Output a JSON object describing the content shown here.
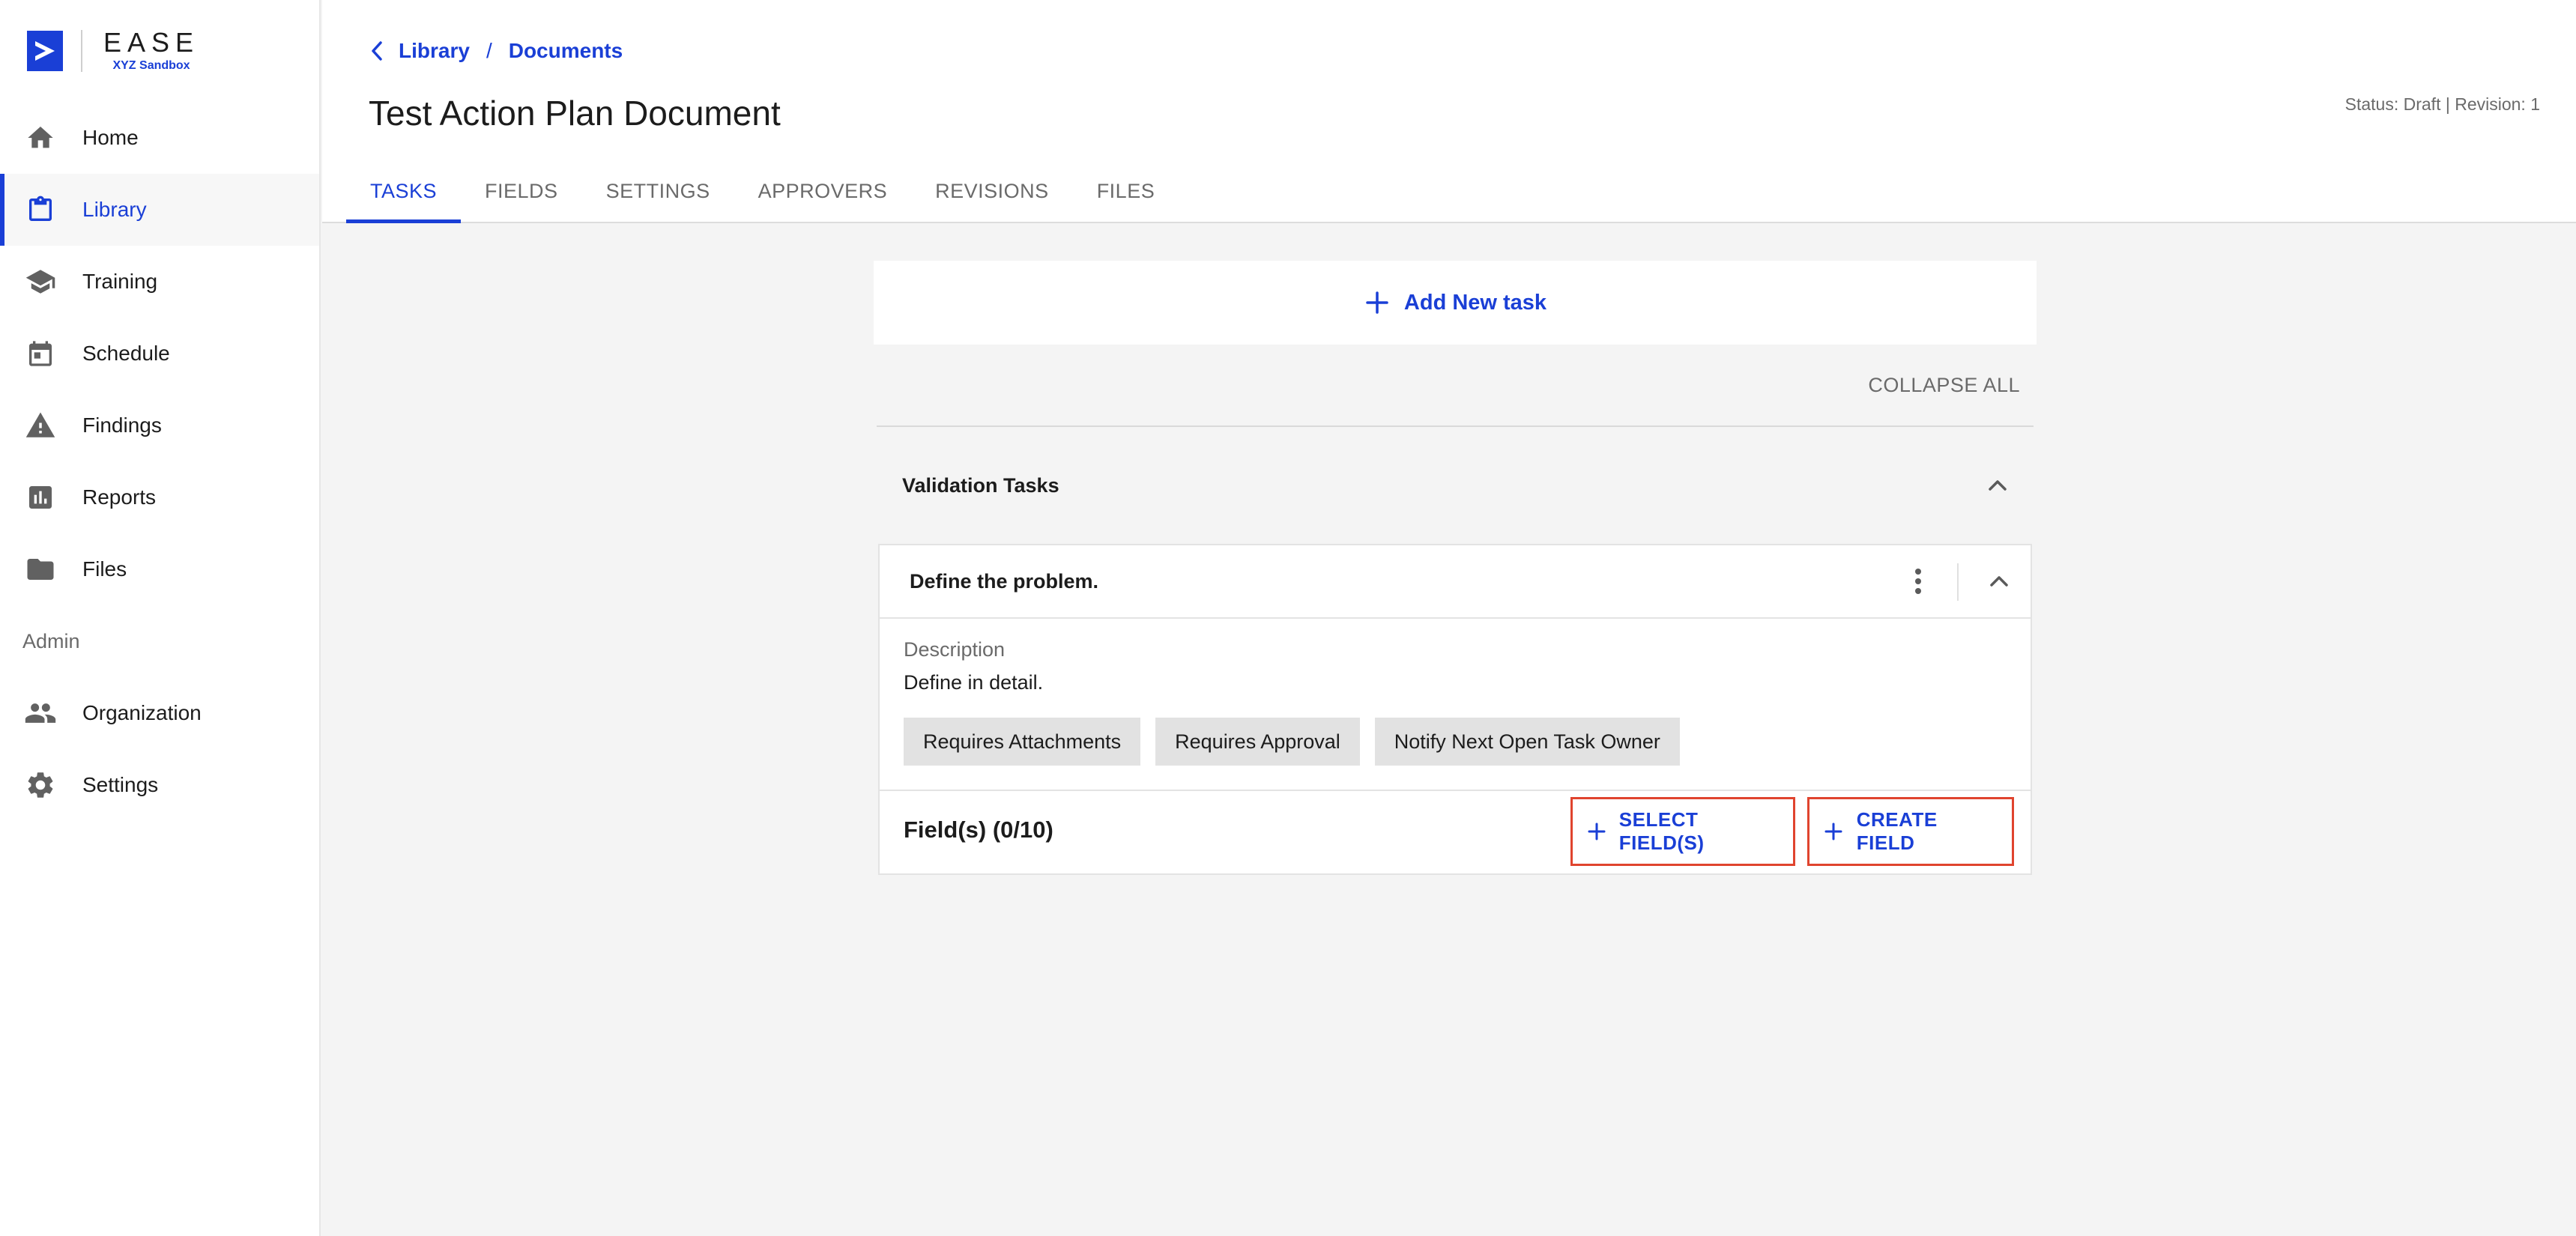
{
  "brand": {
    "title": "EASE",
    "subtitle": "XYZ Sandbox",
    "accent_color": "#1a3fd6"
  },
  "sidebar": {
    "items": [
      {
        "label": "Home",
        "icon": "home-icon",
        "active": false
      },
      {
        "label": "Library",
        "icon": "clipboard-icon",
        "active": true
      },
      {
        "label": "Training",
        "icon": "graduation-cap-icon",
        "active": false
      },
      {
        "label": "Schedule",
        "icon": "calendar-icon",
        "active": false
      },
      {
        "label": "Findings",
        "icon": "warning-icon",
        "active": false
      },
      {
        "label": "Reports",
        "icon": "bar-chart-icon",
        "active": false
      },
      {
        "label": "Files",
        "icon": "folder-icon",
        "active": false
      }
    ],
    "admin_section_label": "Admin",
    "admin_items": [
      {
        "label": "Organization",
        "icon": "people-icon"
      },
      {
        "label": "Settings",
        "icon": "gear-icon"
      }
    ]
  },
  "header": {
    "breadcrumb": [
      "Library",
      "Documents"
    ],
    "breadcrumb_separator": "/",
    "title": "Test Action Plan Document",
    "status": "Status: Draft | Revision: 1",
    "tabs": [
      {
        "label": "TASKS",
        "active": true
      },
      {
        "label": "FIELDS",
        "active": false
      },
      {
        "label": "SETTINGS",
        "active": false
      },
      {
        "label": "APPROVERS",
        "active": false
      },
      {
        "label": "REVISIONS",
        "active": false
      },
      {
        "label": "FILES",
        "active": false
      }
    ]
  },
  "main": {
    "add_task_label": "Add New task",
    "collapse_all_label": "COLLAPSE ALL",
    "group": {
      "title": "Validation Tasks",
      "task": {
        "title": "Define the problem.",
        "description_label": "Description",
        "description": "Define in detail.",
        "chips": [
          "Requires Attachments",
          "Requires Approval",
          "Notify Next Open Task Owner"
        ],
        "fields_label": "Field(s) (0/10)",
        "select_fields_label": "SELECT FIELD(S)",
        "create_field_label": "CREATE FIELD"
      }
    }
  }
}
